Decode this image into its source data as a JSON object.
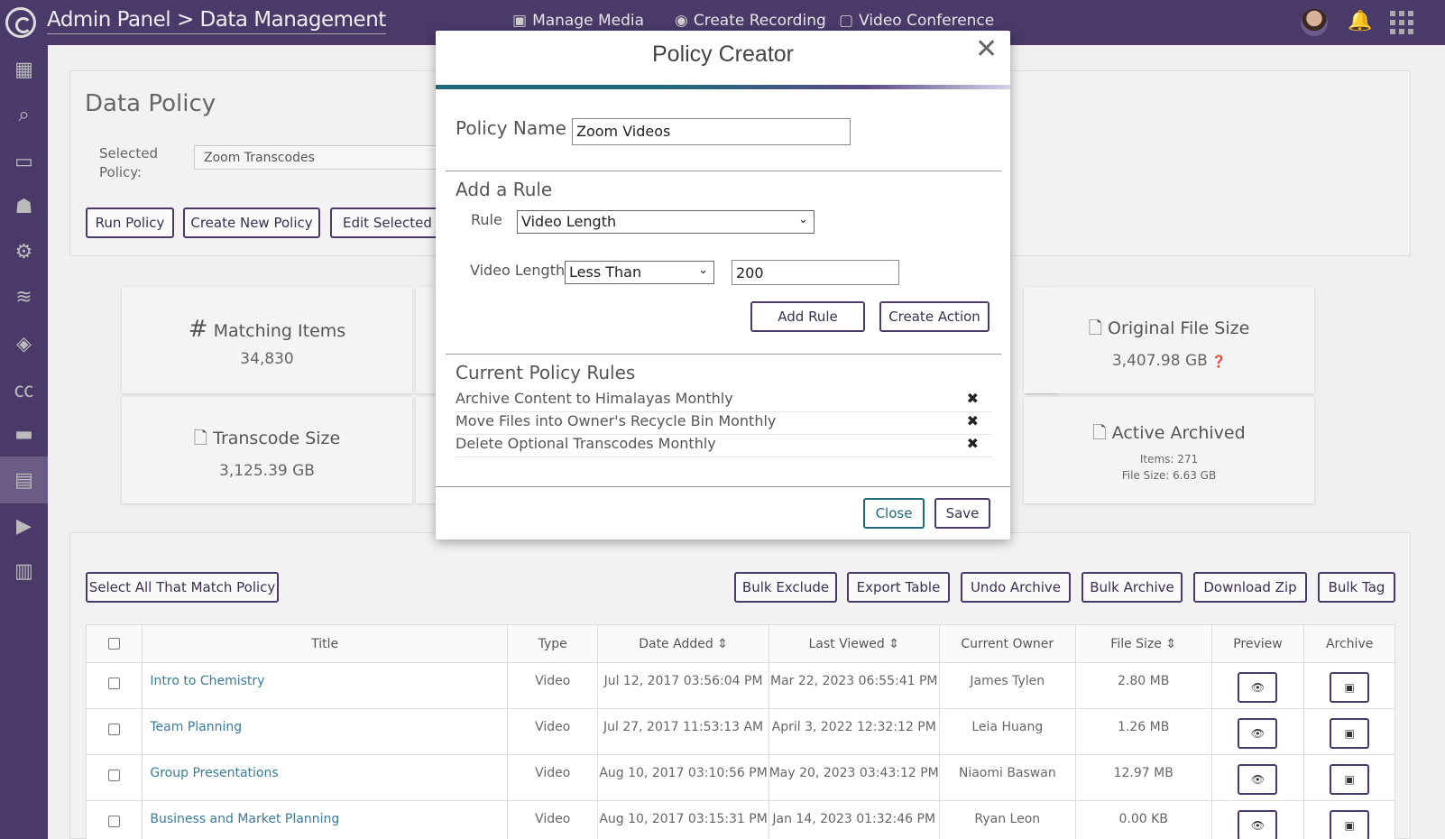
{
  "header": {
    "title": "Admin Panel > Data Management",
    "nav": [
      {
        "label": "Manage Media",
        "icon": "film-icon"
      },
      {
        "label": "Create Recording",
        "icon": "broadcast-icon"
      },
      {
        "label": "Video Conference",
        "icon": "video-conference-icon"
      }
    ]
  },
  "sidebar": {
    "items": [
      {
        "icon": "dashboard-icon"
      },
      {
        "icon": "search-users-icon"
      },
      {
        "icon": "monitor-icon"
      },
      {
        "icon": "groups-icon"
      },
      {
        "icon": "settings-icon"
      },
      {
        "icon": "layers-icon"
      },
      {
        "icon": "paint-icon"
      },
      {
        "icon": "captions-icon"
      },
      {
        "icon": "storage-icon"
      },
      {
        "icon": "archive-icon",
        "active": true
      },
      {
        "icon": "video-settings-icon"
      },
      {
        "icon": "building-icon"
      }
    ]
  },
  "policy": {
    "heading": "Data Policy",
    "selected_label": "Selected Policy:",
    "selected_value": "Zoom Transcodes",
    "buttons": [
      "Run Policy",
      "Create New Policy",
      "Edit Selected Po"
    ]
  },
  "stats": {
    "matching": {
      "label": "Matching Items",
      "value": "34,830"
    },
    "original": {
      "label": "Original File Size",
      "value": "3,407.98 GB"
    },
    "transcode": {
      "label": "Transcode Size",
      "value": "3,125.39 GB"
    },
    "archived": {
      "label": "Active Archived",
      "items": "Items: 271",
      "size": "File Size: 6.63 GB"
    }
  },
  "toolbar": {
    "select_all": "Select All That Match Policy",
    "bulk_exclude": "Bulk Exclude",
    "export_table": "Export Table",
    "undo_archive": "Undo Archive",
    "bulk_archive": "Bulk Archive",
    "download_zip": "Download Zip",
    "bulk_tag": "Bulk Tag"
  },
  "table": {
    "headers": [
      "Title",
      "Type",
      "Date Added",
      "Last Viewed",
      "Current Owner",
      "File Size",
      "Preview",
      "Archive"
    ],
    "rows": [
      {
        "title": "Intro to Chemistry",
        "type": "Video",
        "added": "Jul 12, 2017 03:56:04 PM",
        "viewed": "Mar 22, 2023 06:55:41 PM",
        "owner": "James Tylen",
        "size": "2.80 MB"
      },
      {
        "title": "Team Planning",
        "type": "Video",
        "added": "Jul 27, 2017 11:53:13 AM",
        "viewed": "April 3, 2022 12:32:12 PM",
        "owner": "Leia Huang",
        "size": "1.26 MB"
      },
      {
        "title": "Group Presentations",
        "type": "Video",
        "added": "Aug 10, 2017 03:10:56 PM",
        "viewed": "May 20, 2023 03:43:12 PM",
        "owner": "Niaomi Baswan",
        "size": "12.97 MB"
      },
      {
        "title": "Business and Market Planning",
        "type": "Video",
        "added": "Aug 10, 2017 03:15:31 PM",
        "viewed": "Jan 14, 2023 01:32:46 PM",
        "owner": "Ryan Leon",
        "size": "0.00 KB"
      }
    ]
  },
  "modal": {
    "title": "Policy Creator",
    "policy_name_label": "Policy Name",
    "policy_name_value": "Zoom Videos",
    "add_rule_heading": "Add a Rule",
    "rule_label": "Rule",
    "rule_value": "Video Length",
    "video_length_label": "Video Length:",
    "comparator_value": "Less Than",
    "length_value": "200",
    "add_rule_button": "Add Rule",
    "create_action_button": "Create Action",
    "current_rules_heading": "Current Policy Rules",
    "rules": [
      "Archive Content to Himalayas Monthly",
      "Move Files into Owner's Recycle Bin Monthly",
      "Delete Optional Transcodes Monthly"
    ],
    "close_button": "Close",
    "save_button": "Save"
  },
  "colors": {
    "brand": "#4a3a6a",
    "accent_teal": "#1f6b7a",
    "link": "#3a7a9a"
  }
}
